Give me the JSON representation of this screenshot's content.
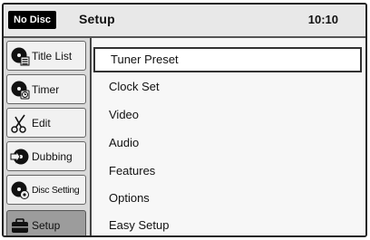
{
  "header": {
    "disc_status": "No Disc",
    "title": "Setup",
    "time": "10:10"
  },
  "sidebar": {
    "items": [
      {
        "label": "Title List",
        "icon": "title-list-icon"
      },
      {
        "label": "Timer",
        "icon": "timer-icon"
      },
      {
        "label": "Edit",
        "icon": "scissors-icon"
      },
      {
        "label": "Dubbing",
        "icon": "dubbing-icon"
      },
      {
        "label": "Disc Setting",
        "icon": "disc-setting-icon"
      },
      {
        "label": "Setup",
        "icon": "toolbox-icon",
        "active": true
      }
    ]
  },
  "menu": {
    "items": [
      {
        "label": "Tuner Preset",
        "selected": true
      },
      {
        "label": "Clock Set"
      },
      {
        "label": "Video"
      },
      {
        "label": "Audio"
      },
      {
        "label": "Features"
      },
      {
        "label": "Options"
      },
      {
        "label": "Easy Setup"
      }
    ]
  }
}
